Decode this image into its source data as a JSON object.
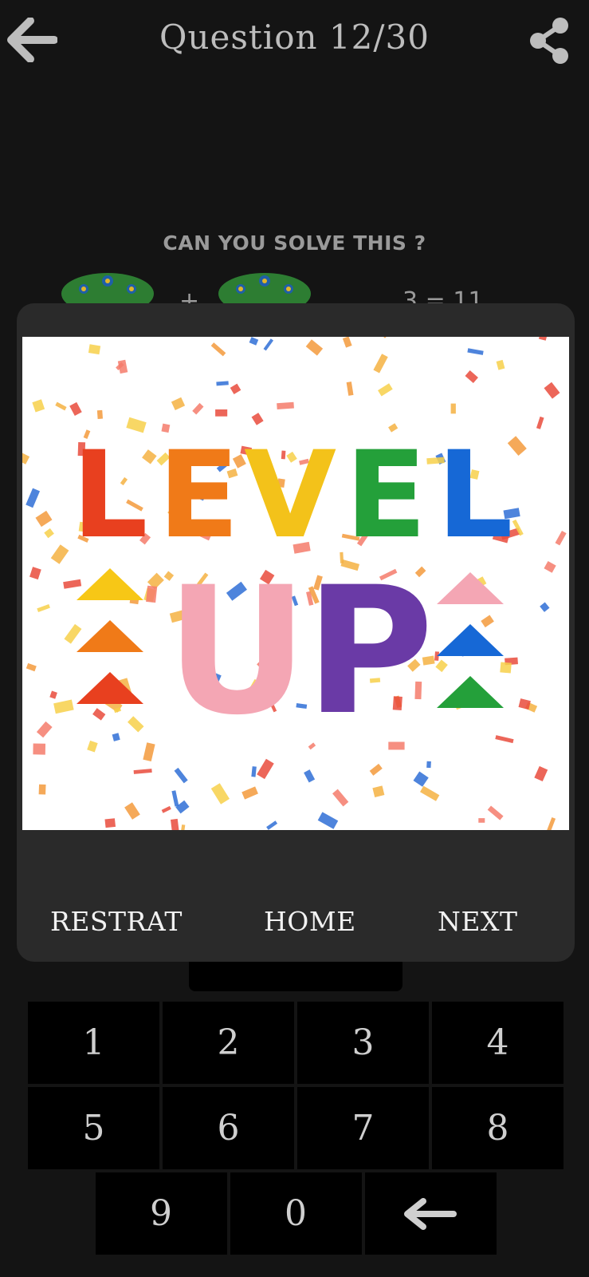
{
  "header": {
    "title": "Question 12/30",
    "back_icon": "arrow-left-icon",
    "share_icon": "share-icon"
  },
  "question": {
    "prompt": "CAN YOU SOLVE THIS ?",
    "peek_left": "+",
    "peek_right": "3 = 11"
  },
  "dialog": {
    "banner_text_top": "LEVEL",
    "banner_text_bottom": "UP",
    "restart_label": "RESTRAT",
    "home_label": "HOME",
    "next_label": "NEXT"
  },
  "keypad": {
    "rows": [
      [
        "1",
        "2",
        "3",
        "4"
      ],
      [
        "5",
        "6",
        "7",
        "8"
      ],
      [
        "9",
        "0"
      ]
    ],
    "backspace_icon": "backspace-arrow-icon"
  },
  "colors": {
    "background": "#141414",
    "dialog": "#2a2a2a",
    "key": "#000000",
    "letters": [
      "#e8401f",
      "#f07a18",
      "#f3c21a",
      "#24a03a",
      "#1668d6"
    ],
    "up_u": "#f4a6b4",
    "up_p": "#6a3aa6"
  }
}
